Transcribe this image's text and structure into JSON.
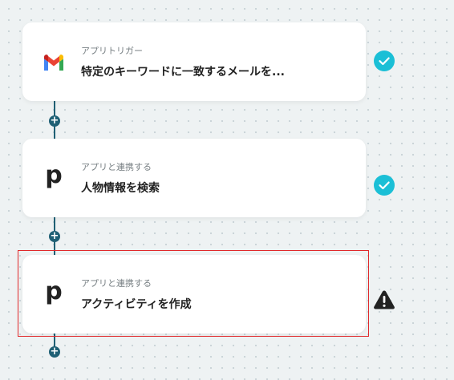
{
  "flow": {
    "steps": [
      {
        "subtitle": "アプリトリガー",
        "title": "特定のキーワードに一致するメールを...",
        "icon": "gmail-logo-icon",
        "status": "completed",
        "status_icon": "check-circle-icon"
      },
      {
        "subtitle": "アプリと連携する",
        "title": "人物情報を検索",
        "icon": "p-app-icon",
        "status": "completed",
        "status_icon": "check-circle-icon"
      },
      {
        "subtitle": "アプリと連携する",
        "title": "アクティビティを作成",
        "icon": "p-app-icon",
        "status": "warning",
        "status_icon": "warning-triangle-icon",
        "selected": true
      }
    ],
    "add_icon": "plus-icon"
  },
  "colors": {
    "background": "#eef2f3",
    "connector": "#1f6075",
    "check": "#1bbfd6",
    "selection_border": "#e0282a",
    "warning": "#222222"
  }
}
